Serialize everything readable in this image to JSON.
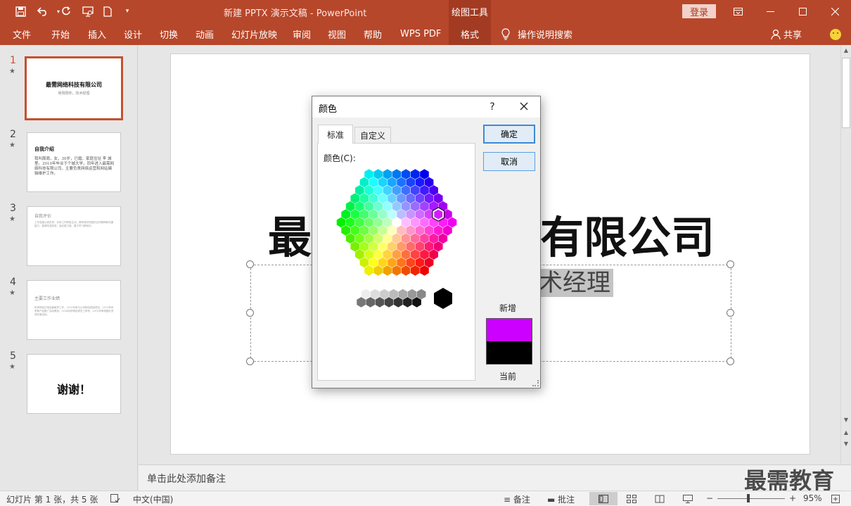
{
  "app": {
    "doc_title": "新建 PPTX 演示文稿  -  PowerPoint",
    "context_tools": "绘图工具",
    "login": "登录"
  },
  "quick_access": [
    "save-icon",
    "undo-icon",
    "redo-icon",
    "slideshow-icon",
    "new-icon",
    "customize-icon"
  ],
  "ribbon": {
    "tabs": [
      "文件",
      "开始",
      "插入",
      "设计",
      "切换",
      "动画",
      "幻灯片放映",
      "审阅",
      "视图",
      "帮助",
      "WPS PDF"
    ],
    "active_tab": "格式",
    "tell_me": "操作说明搜索",
    "share": "共享"
  },
  "thumbnails": [
    {
      "num": "1",
      "title": "最需网络科技有限公司",
      "subtitle": "吴刚刚你，技术经理"
    },
    {
      "num": "2",
      "title": "自我介绍",
      "body": "我叫周周，女，30岁，已婚，家庭住址 李 城里。2010年毕业于个城大学，同年进入最需网络科技有限公司，主要负责网络运营和网站编辑维护工作。"
    },
    {
      "num": "3",
      "title": "自我评价",
      "body": "工作态度认真负责，对待工作积极主动，具有良好的团队合作精神和沟通能力，能够吃苦耐劳，适应能力强，善于学习新知识。"
    },
    {
      "num": "4",
      "title": "主要工作业绩",
      "body": "负责网站日常运营维护工作，2012年参与公司网站改版项目，2013年负责新产品推广活动策划，2014年获得优秀员工称号，2015年带领团队完成年度目标。"
    },
    {
      "num": "5",
      "title": "谢谢！"
    }
  ],
  "slide": {
    "title_left": "最",
    "title_right": "有限公司",
    "subtitle_visible": "术经理"
  },
  "notes": {
    "placeholder": "单击此处添加备注"
  },
  "watermark": "最需教育",
  "statusbar": {
    "slide_info": "幻灯片 第 1 张，共 5 张",
    "language": "中文(中国)",
    "notes_btn": "备注",
    "comments_btn": "批注",
    "zoom": "95%"
  },
  "dialog": {
    "title": "颜色",
    "help": "?",
    "tabs": [
      "标准",
      "自定义"
    ],
    "color_label": "颜色(C):",
    "ok": "确定",
    "cancel": "取消",
    "new_label": "新增",
    "current_label": "当前",
    "new_color": "#cc00ff",
    "current_color": "#000000"
  },
  "colors": {
    "accent": "#b7472a",
    "accent_dark": "#a33b22",
    "selection_border": "#c5502e"
  }
}
